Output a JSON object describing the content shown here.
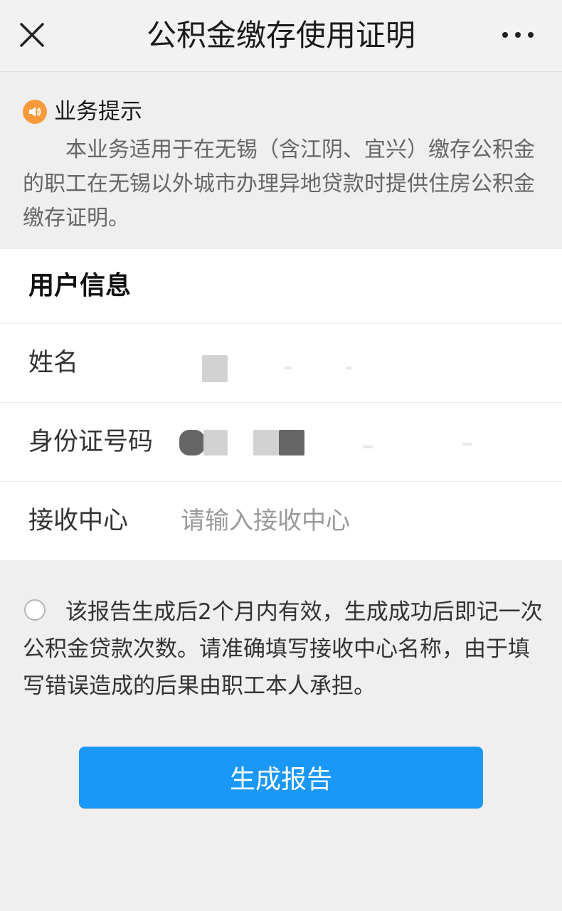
{
  "header": {
    "title": "公积金缴存使用证明",
    "close_icon": "close-icon",
    "more_icon": "more-icon"
  },
  "notice": {
    "icon": "speaker-icon",
    "icon_color": "#f79a3c",
    "title": "业务提示",
    "body": "本业务适用于在无锡（含江阴、宜兴）缴存公积金的职工在无锡以外城市办理异地贷款时提供住房公积金缴存证明。"
  },
  "form": {
    "section_title": "用户信息",
    "name_label": "姓名",
    "id_label": "身份证号码",
    "center_label": "接收中心",
    "center_placeholder": "请输入接收中心",
    "center_value": ""
  },
  "agreement": {
    "text": "该报告生成后2个月内有效，生成成功后即记一次公积金贷款次数。请准确填写接收中心名称，由于填写错误造成的后果由职工本人承担。",
    "checked": false
  },
  "actions": {
    "generate_label": "生成报告",
    "button_color": "#1a98f8"
  }
}
